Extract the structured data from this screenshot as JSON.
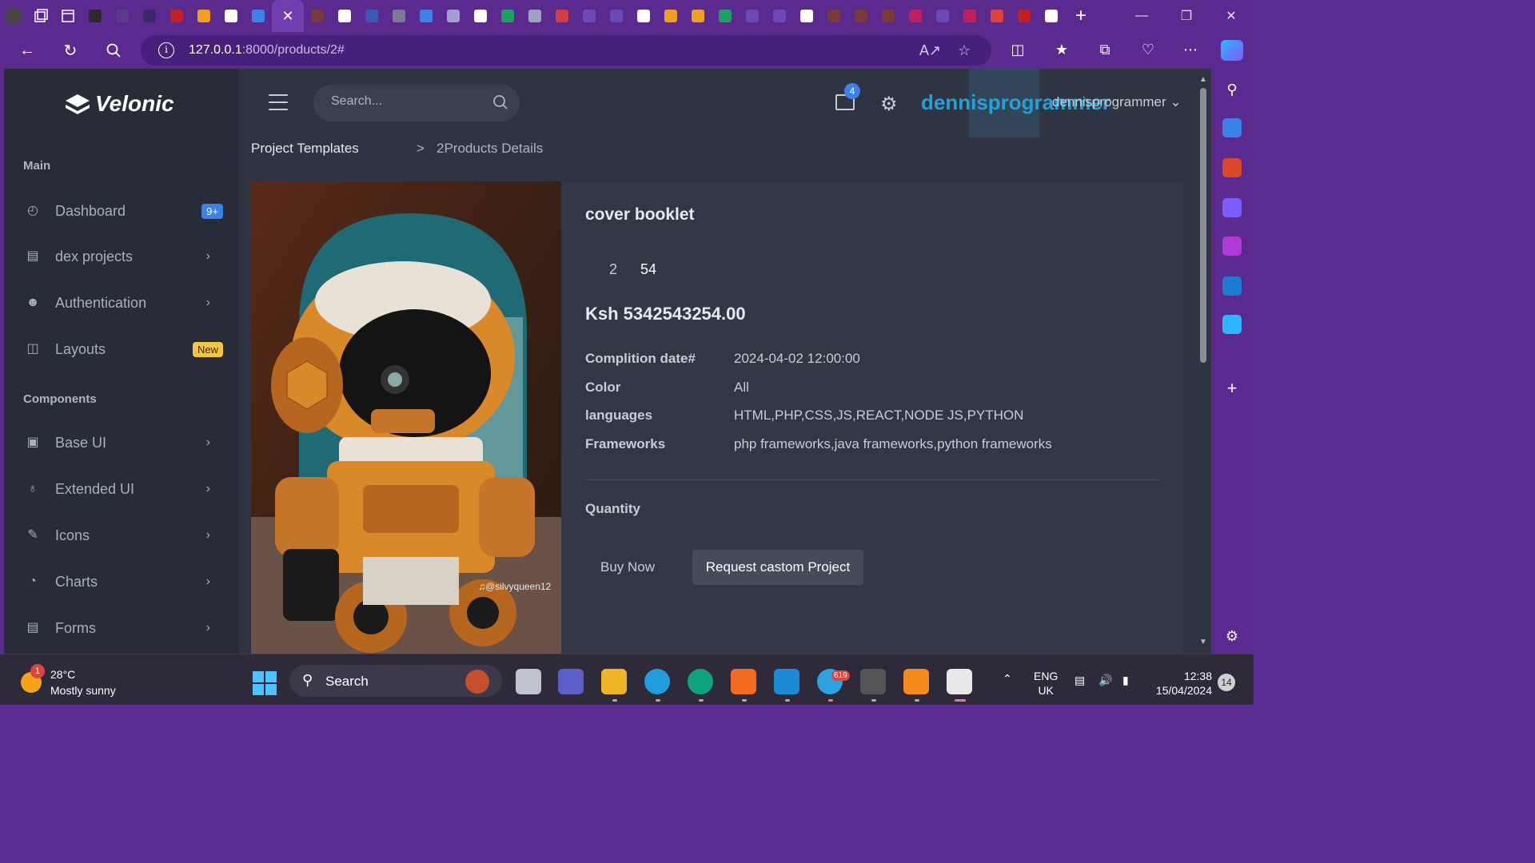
{
  "browser": {
    "url_host": "127.0.0.1",
    "url_rest": ":8000/products/2#",
    "tab_colors": [
      "#2a2a2a",
      "#5a3a8a",
      "#3a2a6a",
      "#c0202a",
      "#f0a020",
      "#ffffff",
      "#3b82e8",
      "#7a3a3a",
      "#ffffff",
      "#3a5ab8",
      "#7a7a9a",
      "#3b82e8",
      "#a0a0d0",
      "#ffffff",
      "#20a060",
      "#a0a0c0",
      "#d04040",
      "#6a4ab8",
      "#6a4ab8",
      "#ffffff",
      "#f0a020",
      "#f0a020",
      "#20a060",
      "#6a4ab8",
      "#6a4ab8",
      "#ffffff",
      "#7a3a3a",
      "#7a3a3a",
      "#7a3a3a",
      "#c02060",
      "#6a4ab8",
      "#c02060",
      "#e04040",
      "#c02020",
      "#ffffff"
    ]
  },
  "app": {
    "brand": "Velonic",
    "accent": "#26a0d6"
  },
  "sidebar": {
    "main_title": "Main",
    "components_title": "Components",
    "items": [
      {
        "label": "Dashboard",
        "icon": "dashboard-icon",
        "badge": "9+",
        "badge_color": "blue"
      },
      {
        "label": "dex projects",
        "icon": "document-icon",
        "chevron": true
      },
      {
        "label": "Authentication",
        "icon": "user-group-icon",
        "chevron": true
      },
      {
        "label": "Layouts",
        "icon": "layout-icon",
        "badge": "New",
        "badge_color": "yellow"
      },
      {
        "label": "Base UI",
        "icon": "briefcase-icon",
        "chevron": true
      },
      {
        "label": "Extended UI",
        "icon": "extended-icon",
        "chevron": true
      },
      {
        "label": "Icons",
        "icon": "icons-icon",
        "chevron": true
      },
      {
        "label": "Charts",
        "icon": "chart-icon",
        "chevron": true
      },
      {
        "label": "Forms",
        "icon": "form-icon",
        "chevron": true
      }
    ]
  },
  "topbar": {
    "search_placeholder": "Search...",
    "mail_count": "4",
    "username_large": "dennisprogrammer",
    "username_small": "dennisprogrammer"
  },
  "breadcrumb": {
    "parent": "Project Templates",
    "separator": ">",
    "current": "2Products Details"
  },
  "product": {
    "title": "cover booklet",
    "num_a": "2",
    "num_b": "54",
    "price": "Ksh 5342543254.00",
    "image_watermark": "@silvyqueen12",
    "specs": [
      {
        "key": "Complition date#",
        "value": "2024-04-02 12:00:00"
      },
      {
        "key": "Color",
        "value": "All"
      },
      {
        "key": "languages",
        "value": "HTML,PHP,CSS,JS,REACT,NODE JS,PYTHON"
      },
      {
        "key": "Frameworks",
        "value": "php frameworks,java frameworks,python frameworks"
      }
    ],
    "quantity_label": "Quantity",
    "buy_label": "Buy Now",
    "request_label": "Request castom Project"
  },
  "taskbar": {
    "weather_temp": "28°C",
    "weather_cond": "Mostly sunny",
    "weather_badge": "1",
    "search_label": "Search",
    "telegram_badge": "619",
    "lang_line1": "ENG",
    "lang_line2": "UK",
    "time": "12:38",
    "date": "15/04/2024",
    "notif_count": "14"
  }
}
